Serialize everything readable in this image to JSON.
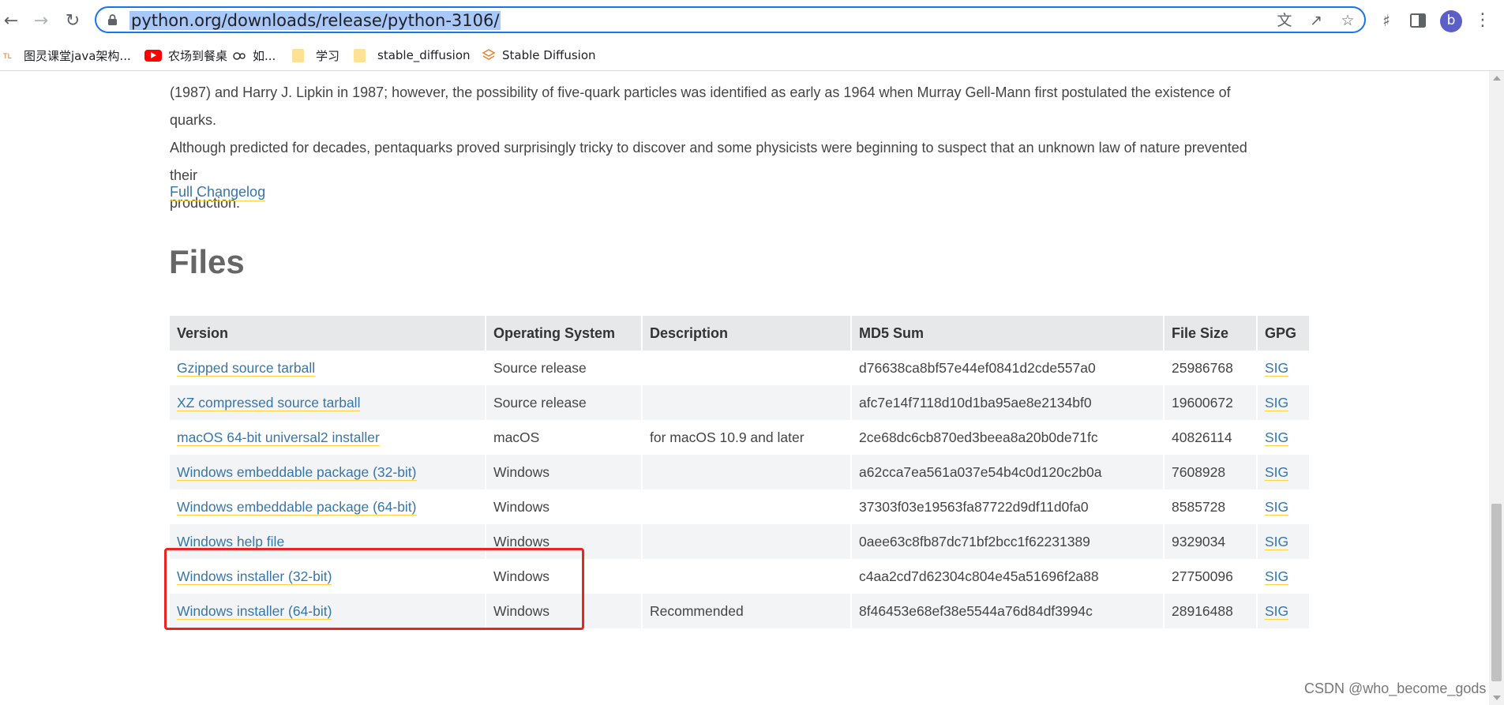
{
  "browser": {
    "url": "python.org/downloads/release/python-3106/",
    "avatar_letter": "b"
  },
  "bookmarks": [
    {
      "label": "图灵课堂java架构..."
    },
    {
      "label": "农场到餐桌"
    },
    {
      "label": "如..."
    },
    {
      "label": "学习"
    },
    {
      "label": "stable_diffusion"
    },
    {
      "label": "Stable Diffusion"
    }
  ],
  "article": {
    "paragraph_line1": "(1987) and Harry J. Lipkin in 1987; however, the possibility of five-quark particles was identified as early as 1964 when Murray Gell-Mann first postulated the existence of quarks.",
    "paragraph_line2": "Although predicted for decades, pentaquarks proved surprisingly tricky to discover and some physicists were beginning to suspect that an unknown law of nature prevented their",
    "paragraph_line3": "production.",
    "changelog_link": "Full Changelog",
    "files_heading": "Files"
  },
  "table": {
    "headers": [
      "Version",
      "Operating System",
      "Description",
      "MD5 Sum",
      "File Size",
      "GPG"
    ],
    "rows": [
      {
        "version": "Gzipped source tarball",
        "os": "Source release",
        "description": "",
        "md5": "d76638ca8bf57e44ef0841d2cde557a0",
        "size": "25986768",
        "gpg": "SIG"
      },
      {
        "version": "XZ compressed source tarball",
        "os": "Source release",
        "description": "",
        "md5": "afc7e14f7118d10d1ba95ae8e2134bf0",
        "size": "19600672",
        "gpg": "SIG"
      },
      {
        "version": "macOS 64-bit universal2 installer",
        "os": "macOS",
        "description": "for macOS 10.9 and later",
        "md5": "2ce68dc6cb870ed3beea8a20b0de71fc",
        "size": "40826114",
        "gpg": "SIG"
      },
      {
        "version": "Windows embeddable package (32-bit)",
        "os": "Windows",
        "description": "",
        "md5": "a62cca7ea561a037e54b4c0d120c2b0a",
        "size": "7608928",
        "gpg": "SIG"
      },
      {
        "version": "Windows embeddable package (64-bit)",
        "os": "Windows",
        "description": "",
        "md5": "37303f03e19563fa87722d9df11d0fa0",
        "size": "8585728",
        "gpg": "SIG"
      },
      {
        "version": "Windows help file",
        "os": "Windows",
        "description": "",
        "md5": "0aee63c8fb87dc71bf2bcc1f62231389",
        "size": "9329034",
        "gpg": "SIG"
      },
      {
        "version": "Windows installer (32-bit)",
        "os": "Windows",
        "description": "",
        "md5": "c4aa2cd7d62304c804e45a51696f2a88",
        "size": "27750096",
        "gpg": "SIG"
      },
      {
        "version": "Windows installer (64-bit)",
        "os": "Windows",
        "description": "Recommended",
        "md5": "8f46453e68ef38e5544a76d84df3994c",
        "size": "28916488",
        "gpg": "SIG"
      }
    ]
  },
  "watermark": "CSDN @who_become_gods",
  "colors": {
    "link": "#3776ab",
    "underline": "#ffd343",
    "highlight_box": "#e8261f",
    "focus_ring": "#1a73e8"
  }
}
